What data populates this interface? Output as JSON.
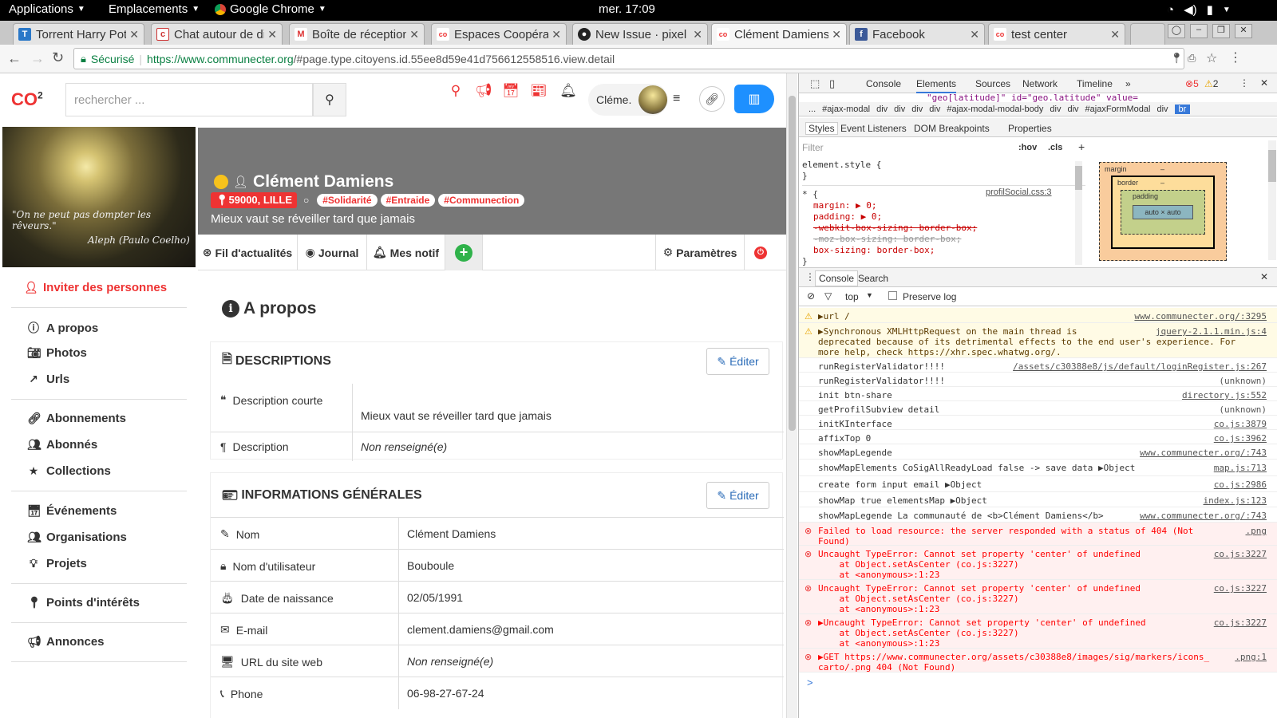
{
  "os_bar": {
    "applications": "Applications",
    "places": "Emplacements",
    "browser": "Google Chrome",
    "clock": "mer. 17:09"
  },
  "tabs": [
    {
      "title": "Torrent Harry Pot",
      "icon": "T"
    },
    {
      "title": "Chat autour de di",
      "icon": "c"
    },
    {
      "title": "Boîte de réception",
      "icon": "M"
    },
    {
      "title": "Espaces Coopérat",
      "icon": "co"
    },
    {
      "title": "New Issue · pixel",
      "icon": "gh"
    },
    {
      "title": "Clément Damiens",
      "icon": "co"
    },
    {
      "title": "Facebook",
      "icon": "f"
    },
    {
      "title": "test center",
      "icon": "co"
    }
  ],
  "address_bar": {
    "secure_label": "Sécurisé",
    "url_host": "https://www.communecter.org",
    "url_path": "/#page.type.citoyens.id.55ee8d59e41d756612558516.view.detail"
  },
  "header": {
    "logo": "CO",
    "logo_sup": "2",
    "search_placeholder": "rechercher ...",
    "user_name": "Cléme."
  },
  "profile": {
    "name": "Clément Damiens",
    "location": "59000, LILLE",
    "tags": [
      "#Solidarité",
      "#Entraide",
      "#Communection"
    ],
    "tagline": "Mieux vaut se réveiller tard que jamais",
    "cover_quote": "\"On ne peut pas dompter les rêveurs.\"",
    "cover_author": "Aleph (Paulo Coelho)"
  },
  "profile_nav": {
    "feed": "Fil d'actualités",
    "journal": "Journal",
    "notifs": "Mes notif",
    "settings": "Paramètres"
  },
  "sidebar": {
    "invite": "Inviter des personnes",
    "items": [
      "A propos",
      "Photos",
      "Urls",
      "Abonnements",
      "Abonnés",
      "Collections",
      "Événements",
      "Organisations",
      "Projets",
      "Points d'intérêts",
      "Annonces"
    ]
  },
  "about": {
    "heading": "A propos",
    "edit_label": "Éditer",
    "descriptions": {
      "title": "DESCRIPTIONS",
      "short_label": "Description courte",
      "short_value": "Mieux vaut se réveiller tard que jamais",
      "desc_label": "Description",
      "desc_value": "Non renseigné(e)"
    },
    "general": {
      "title": "INFORMATIONS GÉNÉRALES",
      "rows": [
        {
          "label": "Nom",
          "value": "Clément Damiens"
        },
        {
          "label": "Nom d'utilisateur",
          "value": "Bouboule"
        },
        {
          "label": "Date de naissance",
          "value": "02/05/1991"
        },
        {
          "label": "E-mail",
          "value": "clement.damiens@gmail.com"
        },
        {
          "label": "URL du site web",
          "value": "Non renseigné(e)"
        },
        {
          "label": "Phone",
          "value": "06-98-27-67-24"
        }
      ]
    }
  },
  "devtools": {
    "tabs": [
      "Console",
      "Elements",
      "Sources",
      "Network",
      "Timeline"
    ],
    "errors": "5",
    "warnings": "2",
    "dom_line": "\"geo[latitude]\" id=\"geo.latitude\" value=",
    "breadcrumb": [
      "...",
      "#ajax-modal",
      "div",
      "div",
      "div",
      "div",
      "#ajax-modal-modal-body",
      "div",
      "div",
      "#ajaxFormModal",
      "div",
      "br"
    ],
    "subtabs": [
      "Styles",
      "Event Listeners",
      "DOM Breakpoints",
      "Properties"
    ],
    "filter_placeholder": "Filter",
    "hov": ":hov",
    "cls": ".cls",
    "style_lines": [
      "element.style {",
      "}",
      "* {",
      "margin: ▶ 0;",
      "padding: ▶ 0;",
      "-webkit-box-sizing: border-box;",
      "-moz-box-sizing: border-box;",
      "box-sizing: border-box;",
      "}"
    ],
    "style_source": "profilSocial.css:3",
    "box_model": {
      "margin": "margin",
      "border": "border",
      "padding": "padding",
      "content": "auto × auto",
      "dash": "–"
    },
    "drawer_tabs": [
      "Console",
      "Search"
    ],
    "context": "top",
    "preserve_log": "Preserve log",
    "console": [
      {
        "level": "warn",
        "text": "▶url /",
        "src": "www.communecter.org/:3295"
      },
      {
        "level": "warn",
        "text": "▶Synchronous XMLHttpRequest on the main thread is\ndeprecated because of its detrimental effects to the end user's experience. For\nmore help, check https://xhr.spec.whatwg.org/.",
        "src": "jquery-2.1.1.min.js:4"
      },
      {
        "level": "log",
        "text": "runRegisterValidator!!!!",
        "src": "/assets/c30388e8/js/default/loginRegister.js:267"
      },
      {
        "level": "log",
        "text": "runRegisterValidator!!!!",
        "src": "(unknown)"
      },
      {
        "level": "log",
        "text": "init btn-share",
        "src": "directory.js:552"
      },
      {
        "level": "log",
        "text": "getProfilSubview detail",
        "src": "(unknown)"
      },
      {
        "level": "log",
        "text": "initKInterface",
        "src": "co.js:3879"
      },
      {
        "level": "log",
        "text": "affixTop 0",
        "src": "co.js:3962"
      },
      {
        "level": "log",
        "text": "showMapLegende",
        "src": "www.communecter.org/:743"
      },
      {
        "level": "log",
        "text": "showMapElements CoSigAllReadyLoad false -> save data ▶Object",
        "src": "map.js:713"
      },
      {
        "level": "log",
        "text": "create form input email ▶Object",
        "src": "co.js:2986"
      },
      {
        "level": "log",
        "text": "showMap true elementsMap ▶Object",
        "src": "index.js:123"
      },
      {
        "level": "log",
        "text": "showMapLegende La communauté de <b>Clément Damiens</b>",
        "src": "www.communecter.org/:743"
      },
      {
        "level": "error",
        "text": "Failed to load resource: the server responded with a status of 404 (Not\nFound)",
        "src": ".png"
      },
      {
        "level": "error",
        "text": "Uncaught TypeError: Cannot set property 'center' of undefined\n    at Object.setAsCenter (co.js:3227)\n    at <anonymous>:1:23",
        "src": "co.js:3227"
      },
      {
        "level": "error",
        "text": "Uncaught TypeError: Cannot set property 'center' of undefined\n    at Object.setAsCenter (co.js:3227)\n    at <anonymous>:1:23",
        "src": "co.js:3227"
      },
      {
        "level": "error",
        "text": "▶Uncaught TypeError: Cannot set property 'center' of undefined\n    at Object.setAsCenter (co.js:3227)\n    at <anonymous>:1:23",
        "src": "co.js:3227"
      },
      {
        "level": "error",
        "text": "▶GET https://www.communecter.org/assets/c30388e8/images/sig/markers/icons_\ncarto/.png 404 (Not Found)",
        "src": ".png:1"
      }
    ],
    "prompt": ">"
  }
}
